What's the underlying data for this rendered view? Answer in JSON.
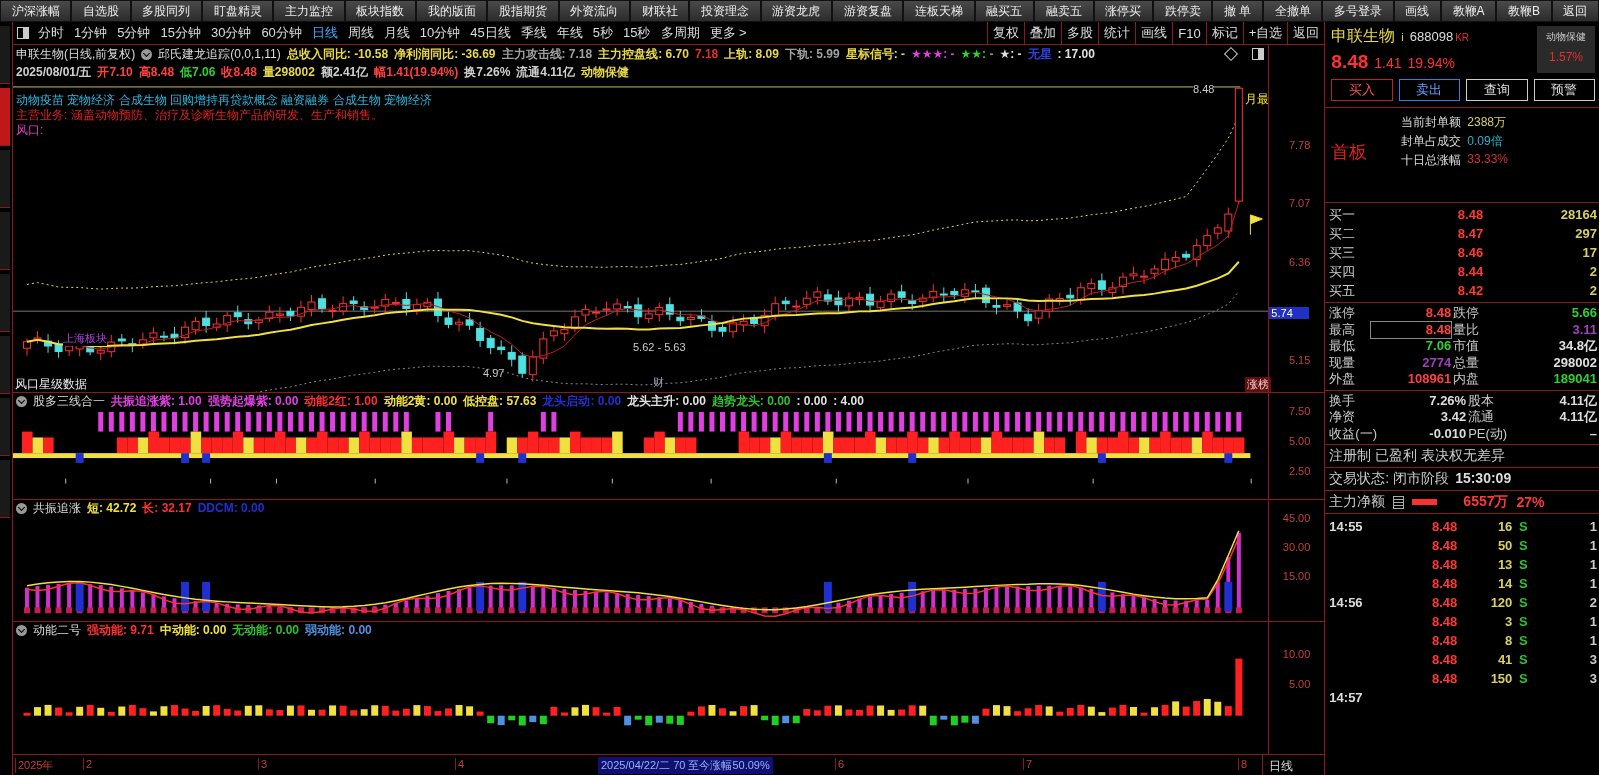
{
  "toolbar": {
    "buttons": [
      "沪深涨幅",
      "自选股",
      "多股同列",
      "盯盘精灵",
      "主力监控",
      "板块指数",
      "我的版面",
      "股指期货",
      "外资流向",
      "财联社",
      "投资理念",
      "游资龙虎",
      "游资复盘",
      "连板天梯",
      "融买五",
      "融卖五",
      "涨停买",
      "跌停卖",
      "撤 单",
      "全撤单",
      "多号登录",
      "画线",
      "教鞭A",
      "教鞭B",
      "返回"
    ]
  },
  "left_strip": {
    "tabs": [
      {
        "selected": false
      },
      {
        "selected": true
      },
      {
        "selected": false
      },
      {
        "selected": false
      },
      {
        "selected": false
      },
      {
        "selected": false
      },
      {
        "selected": false
      },
      {
        "selected": false
      }
    ]
  },
  "period_bar": {
    "periods": [
      {
        "label": "分时",
        "selected": false
      },
      {
        "label": "1分钟",
        "selected": false
      },
      {
        "label": "5分钟",
        "selected": false
      },
      {
        "label": "15分钟",
        "selected": false
      },
      {
        "label": "30分钟",
        "selected": false
      },
      {
        "label": "60分钟",
        "selected": false
      },
      {
        "label": "日线",
        "selected": true
      },
      {
        "label": "周线",
        "selected": false
      },
      {
        "label": "月线",
        "selected": false
      },
      {
        "label": "10分钟",
        "selected": false
      },
      {
        "label": "45日线",
        "selected": false
      },
      {
        "label": "季线",
        "selected": false
      },
      {
        "label": "年线",
        "selected": false
      },
      {
        "label": "5秒",
        "selected": false
      },
      {
        "label": "15秒",
        "selected": false
      },
      {
        "label": "多周期",
        "selected": false
      }
    ],
    "more": "更多 >",
    "tools": [
      "复权",
      "叠加",
      "多股",
      "统计",
      "画线",
      "F10",
      "标记",
      "+自选",
      "返回"
    ]
  },
  "main_chart": {
    "title": "申联生物(日线,前复权)",
    "indicator": "邱氏建龙追踪(0,0,1,11)",
    "indicator_values": [
      {
        "text": "总收入同比: -10.58",
        "color": "#e8d84a"
      },
      {
        "text": "净利润同比: -36.69",
        "color": "#e8d84a"
      },
      {
        "text": "主力攻击线: 7.18",
        "color": "#a0a0a0"
      },
      {
        "text": "主力控盘线: 6.70",
        "color": "#e8d84a"
      },
      {
        "text": "7.18",
        "color": "#e03030"
      },
      {
        "text": "上轨: 8.09",
        "color": "#e8d84a"
      },
      {
        "text": "下轨: 5.99",
        "color": "#a0a0a0"
      },
      {
        "text": "星标信号: -",
        "color": "#e8d84a"
      },
      {
        "text": "★★★: -",
        "color": "#e040e0"
      },
      {
        "text": "★★: -",
        "color": "#30d030"
      },
      {
        "text": "★: -",
        "color": "#e0e0e0"
      },
      {
        "text": "无星",
        "color": "#3040e0"
      },
      {
        "text": ": 17.00",
        "color": "#e0e0e0"
      }
    ],
    "quote": [
      {
        "text": "2025/08/01/五",
        "color": "#d0d0d0"
      },
      {
        "text": "开7.10",
        "color": "#ff4040"
      },
      {
        "text": "高8.48",
        "color": "#ff4040"
      },
      {
        "text": "低7.06",
        "color": "#30d030"
      },
      {
        "text": "收8.48",
        "color": "#ff4040"
      },
      {
        "text": "量298002",
        "color": "#e8d84a"
      },
      {
        "text": "额2.41亿",
        "color": "#d0d0d0"
      },
      {
        "text": "幅1.41(19.94%)",
        "color": "#ff4040"
      },
      {
        "text": "换7.26%",
        "color": "#d0d0d0"
      },
      {
        "text": "流通4.11亿",
        "color": "#d0d0d0"
      },
      {
        "text": "动物保健",
        "color": "#e8d84a"
      }
    ],
    "concepts": "动物疫苗 宠物经济 合成生物 回购增持再贷款概念 融资融券 合成生物 宠物经济",
    "business": "主营业务: 涵盖动物预防、治疗及诊断生物产品的研发、生产和销售。",
    "wind": "风口:",
    "annotations": [
      "8.48",
      "月最",
      "5.62 - 5.63",
      "4.97",
      "财",
      "涨榜",
      "上海板块",
      "风口星级数据"
    ],
    "axis": [
      "7.78",
      "7.07",
      "6.36",
      "5.15"
    ],
    "price_tag": "5.74"
  },
  "indicator_1": {
    "name": "股多三线合一",
    "values": [
      {
        "text": "共振追涨紫: 1.00",
        "color": "#e040e0"
      },
      {
        "text": "强势起爆紫: 0.00",
        "color": "#e040e0"
      },
      {
        "text": "动能2红: 1.00",
        "color": "#ff3030"
      },
      {
        "text": "动能2黄: 0.00",
        "color": "#f0e040"
      },
      {
        "text": "低控盘: 57.63",
        "color": "#f0e040"
      },
      {
        "text": "龙头启动: 0.00",
        "color": "#2030d0"
      },
      {
        "text": "龙头主升: 0.00",
        "color": "#e0e0e0"
      },
      {
        "text": "趋势龙头: 0.00",
        "color": "#30c030"
      },
      {
        "text": ": 0.00",
        "color": "#e0e0e0"
      },
      {
        "text": ": 4.00",
        "color": "#e0e0e0"
      }
    ],
    "axis": [
      "7.50",
      "5.00",
      "2.50"
    ]
  },
  "indicator_2": {
    "name": "共振追涨",
    "values": [
      {
        "text": "短: 42.72",
        "color": "#f0e040"
      },
      {
        "text": "长: 32.17",
        "color": "#ff3030"
      },
      {
        "text": "DDCM: 0.00",
        "color": "#2030d0"
      }
    ],
    "axis": [
      "45.00",
      "30.00",
      "15.00"
    ]
  },
  "indicator_3": {
    "name": "动能二号",
    "values": [
      {
        "text": "强动能: 9.71",
        "color": "#ff3030"
      },
      {
        "text": "中动能: 0.00",
        "color": "#f0e040"
      },
      {
        "text": "无动能: 0.00",
        "color": "#30c030"
      },
      {
        "text": "弱动能: 0.00",
        "color": "#5090e0"
      }
    ],
    "axis": [
      "10.00",
      "5.00"
    ]
  },
  "date_axis": {
    "labels": [
      "2025年",
      "2",
      "3",
      "4",
      "6",
      "7",
      "8"
    ],
    "range_note": "2025/04/22/二 70 至今涨幅50.09%",
    "period": "日线"
  },
  "quote_panel": {
    "name": "申联生物",
    "info_mark": "i",
    "code": "688098",
    "market": "KR",
    "sector": "动物保健",
    "sector_change": "1.57%",
    "price": "8.48",
    "change": "1.41",
    "change_pct": "19.94%",
    "actions": [
      "买入",
      "卖出",
      "查询",
      "预警"
    ],
    "board": "首板",
    "seal": [
      {
        "label": "当前封单额",
        "value": "2388万",
        "color": "#d8d060"
      },
      {
        "label": "封单占成交",
        "value": "0.09倍",
        "color": "#30b0d0"
      },
      {
        "label": "十日总涨幅",
        "value": "33.33%",
        "color": "#d03040"
      }
    ],
    "bids": [
      {
        "label": "买一",
        "price": "8.48",
        "volume": "28164"
      },
      {
        "label": "买二",
        "price": "8.47",
        "volume": "297"
      },
      {
        "label": "买三",
        "price": "8.46",
        "volume": "17"
      },
      {
        "label": "买四",
        "price": "8.44",
        "volume": "2"
      },
      {
        "label": "买五",
        "price": "8.42",
        "volume": "2"
      }
    ],
    "stats": [
      {
        "label": "涨停",
        "value": "8.48",
        "color": "#ff4040"
      },
      {
        "label": "跌停",
        "value": "5.66",
        "color": "#30d030"
      },
      {
        "label": "最高",
        "value": "8.48",
        "color": "#ff4040"
      },
      {
        "label": "量比",
        "value": "3.11",
        "color": "#a040c0"
      },
      {
        "label": "最低",
        "value": "7.06",
        "color": "#30d030"
      },
      {
        "label": "市值",
        "value": "34.8亿",
        "color": "#e0e0e0"
      },
      {
        "label": "现量",
        "value": "2774",
        "color": "#a040c0"
      },
      {
        "label": "总量",
        "value": "298002",
        "color": "#e0e0e0"
      },
      {
        "label": "外盘",
        "value": "108961",
        "color": "#ff4040"
      },
      {
        "label": "内盘",
        "value": "189041",
        "color": "#30d030"
      }
    ],
    "fundamentals": [
      {
        "label": "换手",
        "value": "7.26%"
      },
      {
        "label": "股本",
        "value": "4.11亿"
      },
      {
        "label": "净资",
        "value": "3.42"
      },
      {
        "label": "流通",
        "value": "4.11亿"
      },
      {
        "label": "收益(一)",
        "value": "-0.010"
      },
      {
        "label": "PE(动)",
        "value": "–"
      }
    ],
    "tags": "注册制 已盈利 表决权无差异",
    "status_label": "交易状态: 闭市阶段",
    "status_time": "15:30:09",
    "main_net_label": "主力净额",
    "main_net_value": "6557万",
    "main_net_pct": "27%",
    "ticks": [
      {
        "time": "14:55",
        "price": "8.48",
        "volume": "16",
        "flag": "S",
        "column_5": "1"
      },
      {
        "price": "8.48",
        "volume": "50",
        "flag": "S",
        "column_5": "1"
      },
      {
        "price": "8.48",
        "volume": "13",
        "flag": "S",
        "column_5": "1"
      },
      {
        "price": "8.48",
        "volume": "14",
        "flag": "S",
        "column_5": "1"
      },
      {
        "time": "14:56",
        "price": "8.48",
        "volume": "120",
        "flag": "S",
        "column_5": "2"
      },
      {
        "price": "8.48",
        "volume": "3",
        "flag": "S",
        "column_5": "1"
      },
      {
        "price": "8.48",
        "volume": "8",
        "flag": "S",
        "column_5": "1"
      },
      {
        "price": "8.48",
        "volume": "41",
        "flag": "S",
        "column_5": "3"
      },
      {
        "price": "8.48",
        "volume": "150",
        "flag": "S",
        "column_5": "3"
      },
      {
        "time": "14:57"
      }
    ]
  }
}
